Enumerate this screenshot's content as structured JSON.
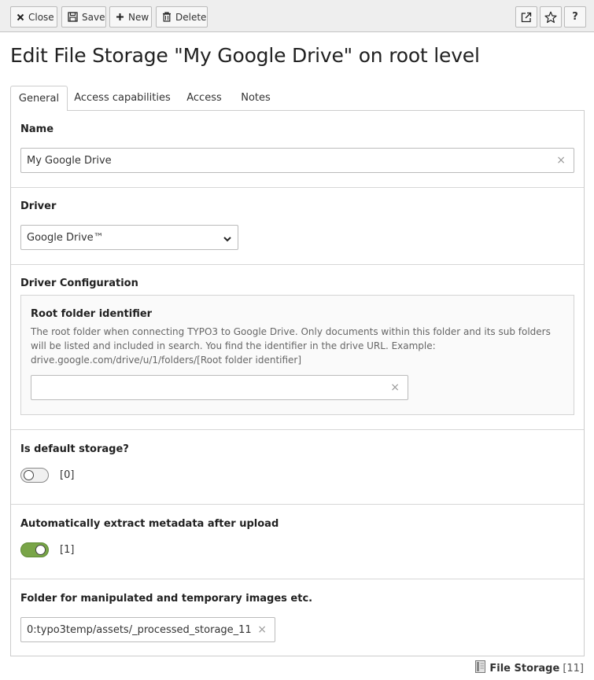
{
  "toolbar": {
    "close_label": "Close",
    "save_label": "Save",
    "new_label": "New",
    "delete_label": "Delete",
    "help_label": "?"
  },
  "page": {
    "title": "Edit File Storage \"My Google Drive\" on root level"
  },
  "tabs": [
    {
      "label": "General",
      "active": true
    },
    {
      "label": "Access capabilities",
      "active": false
    },
    {
      "label": "Access",
      "active": false
    },
    {
      "label": "Notes",
      "active": false
    }
  ],
  "form": {
    "name": {
      "label": "Name",
      "value": "My Google Drive",
      "clear": "×"
    },
    "driver": {
      "label": "Driver",
      "selected": "Google Drive™"
    },
    "driver_configuration": {
      "label": "Driver Configuration",
      "root_folder": {
        "label": "Root folder identifier",
        "help": "The root folder when connecting TYPO3 to Google Drive. Only documents within this folder and its sub folders will be listed and included in search. You find the identifier in the drive URL. Example: drive.google.com/drive/u/1/folders/[Root folder identifier]",
        "value": "",
        "clear": "×"
      }
    },
    "is_default": {
      "label": "Is default storage?",
      "checked": false,
      "value_text": "[0]"
    },
    "auto_extract": {
      "label": "Automatically extract metadata after upload",
      "checked": true,
      "value_text": "[1]"
    },
    "processing_folder": {
      "label": "Folder for manipulated and temporary images etc.",
      "value": "0:typo3temp/assets/_processed_storage_11",
      "clear": "×"
    }
  },
  "footer": {
    "record_type": "File Storage",
    "record_id": "[11]"
  },
  "colors": {
    "toggle_on": "#79a548",
    "toolbar_bg": "#eeeeee"
  }
}
